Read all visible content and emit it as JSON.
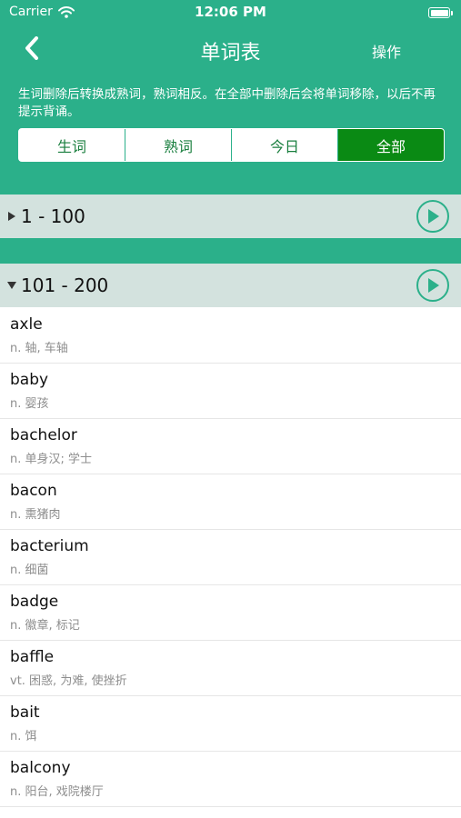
{
  "status_bar": {
    "carrier": "Carrier",
    "time": "12:06 PM"
  },
  "nav": {
    "title": "单词表",
    "action": "操作"
  },
  "notice": "生词删除后转换成熟词，熟词相反。在全部中删除后会将单词移除，以后不再提示背诵。",
  "tabs": [
    {
      "label": "生词",
      "active": false
    },
    {
      "label": "熟词",
      "active": false
    },
    {
      "label": "今日",
      "active": false
    },
    {
      "label": "全部",
      "active": true
    }
  ],
  "groups": [
    {
      "label": "1 - 100",
      "expanded": false
    },
    {
      "label": "101 - 200",
      "expanded": true
    }
  ],
  "words": [
    {
      "word": "axle",
      "def": "n. 轴, 车轴"
    },
    {
      "word": "baby",
      "def": "n. 婴孩"
    },
    {
      "word": "bachelor",
      "def": "n. 单身汉; 学士"
    },
    {
      "word": "bacon",
      "def": "n. 熏猪肉"
    },
    {
      "word": "bacterium",
      "def": "n. 细菌"
    },
    {
      "word": "badge",
      "def": "n. 徽章, 标记"
    },
    {
      "word": "baffle",
      "def": "vt. 困惑, 为难, 使挫折"
    },
    {
      "word": "bait",
      "def": "n. 饵"
    },
    {
      "word": "balcony",
      "def": "n. 阳台, 戏院楼厅"
    }
  ],
  "colors": {
    "header": "#2bb08a",
    "active_tab": "#0a8a14",
    "group_bg": "#d3e2de"
  }
}
